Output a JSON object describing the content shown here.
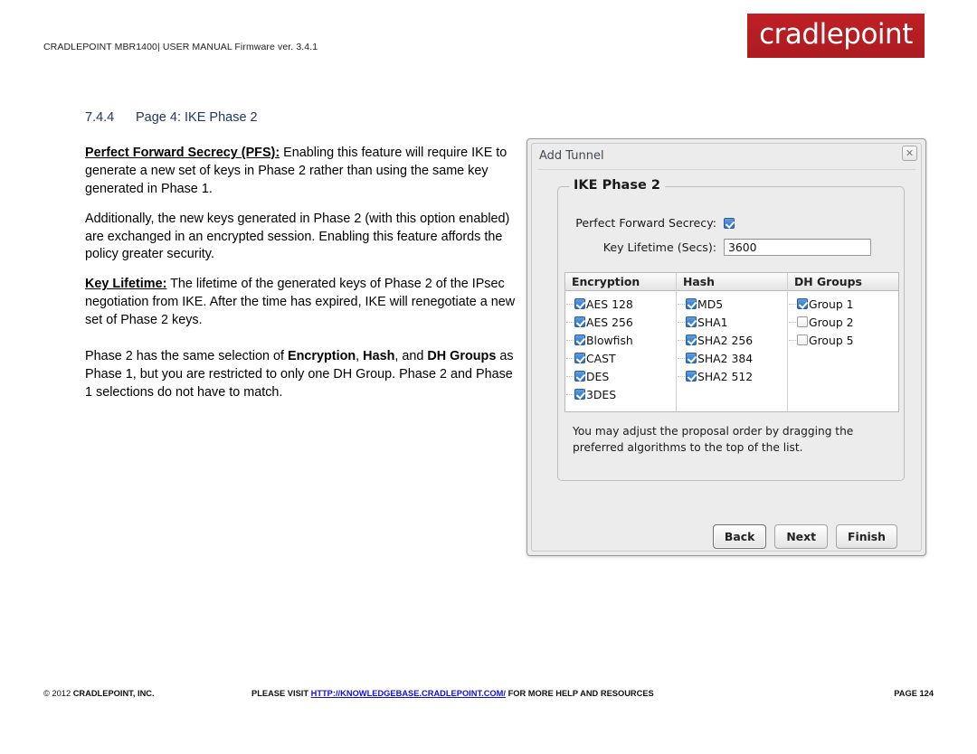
{
  "header": {
    "meta": "CRADLEPOINT MBR1400| USER MANUAL Firmware ver. 3.4.1",
    "logo_text": "cradlepoint",
    "logo_color": "#b81f24"
  },
  "section": {
    "number": "7.4.4",
    "title": "Page 4: IKE Phase 2",
    "color": "#1f3864"
  },
  "body": {
    "p1_lead": "Perfect Forward Secrecy (PFS):",
    "p1_text": " Enabling this feature will require IKE to generate a new set of keys in Phase 2 rather than using the same key generated in Phase 1.",
    "p2_text": "Additionally, the new keys generated in Phase 2 (with this option enabled) are exchanged in an encrypted session. Enabling this feature affords the policy greater security.",
    "p3_lead": "Key Lifetime:",
    "p3_text": " The lifetime of the generated keys of Phase 2 of the IPsec negotiation from IKE. After the time has expired, IKE will renegotiate a new set of Phase 2 keys.",
    "p4_part1": "Phase 2 has the same selection of ",
    "p4_bold1": "Encryption",
    "p4_part2": ", ",
    "p4_bold2": "Hash",
    "p4_part3": ", and ",
    "p4_bold3": "DH Groups",
    "p4_part4": " as Phase 1, but you are restricted to only one DH Group. Phase 2 and Phase 1 selections do not have to match."
  },
  "dialog": {
    "title": "Add Tunnel",
    "close_icon": "close-icon",
    "close_glyph": "✕",
    "fieldset_legend": "IKE Phase 2",
    "pfs": {
      "label": "Perfect Forward Secrecy:",
      "checked": true
    },
    "key_lifetime": {
      "label": "Key Lifetime (Secs):",
      "value": "3600",
      "placeholder": ""
    },
    "table": {
      "columns": [
        {
          "header": "Encryption",
          "options": [
            {
              "label": "AES 128",
              "checked": true
            },
            {
              "label": "AES 256",
              "checked": true
            },
            {
              "label": "Blowfish",
              "checked": true
            },
            {
              "label": "CAST",
              "checked": true
            },
            {
              "label": "DES",
              "checked": true
            },
            {
              "label": "3DES",
              "checked": true
            }
          ]
        },
        {
          "header": "Hash",
          "options": [
            {
              "label": "MD5",
              "checked": true
            },
            {
              "label": "SHA1",
              "checked": true
            },
            {
              "label": "SHA2 256",
              "checked": true
            },
            {
              "label": "SHA2 384",
              "checked": true
            },
            {
              "label": "SHA2 512",
              "checked": true
            }
          ]
        },
        {
          "header": "DH Groups",
          "options": [
            {
              "label": "Group 1",
              "checked": true
            },
            {
              "label": "Group 2",
              "checked": false
            },
            {
              "label": "Group 5",
              "checked": false
            }
          ]
        }
      ]
    },
    "hint": "You may adjust the proposal order by dragging the preferred algorithms to the top of the list.",
    "buttons": [
      {
        "label": "Back",
        "focused": true
      },
      {
        "label": "Next",
        "focused": false
      },
      {
        "label": "Finish",
        "focused": false
      }
    ]
  },
  "footer": {
    "copyright_symbol": "© 2012 ",
    "company": "CRADLEPOINT, INC.",
    "visit_prefix": "PLEASE VISIT ",
    "link": "HTTP://KNOWLEDGEBASE.CRADLEPOINT.COM/",
    "visit_suffix": " FOR MORE HELP AND RESOURCES",
    "page": "PAGE 124"
  }
}
